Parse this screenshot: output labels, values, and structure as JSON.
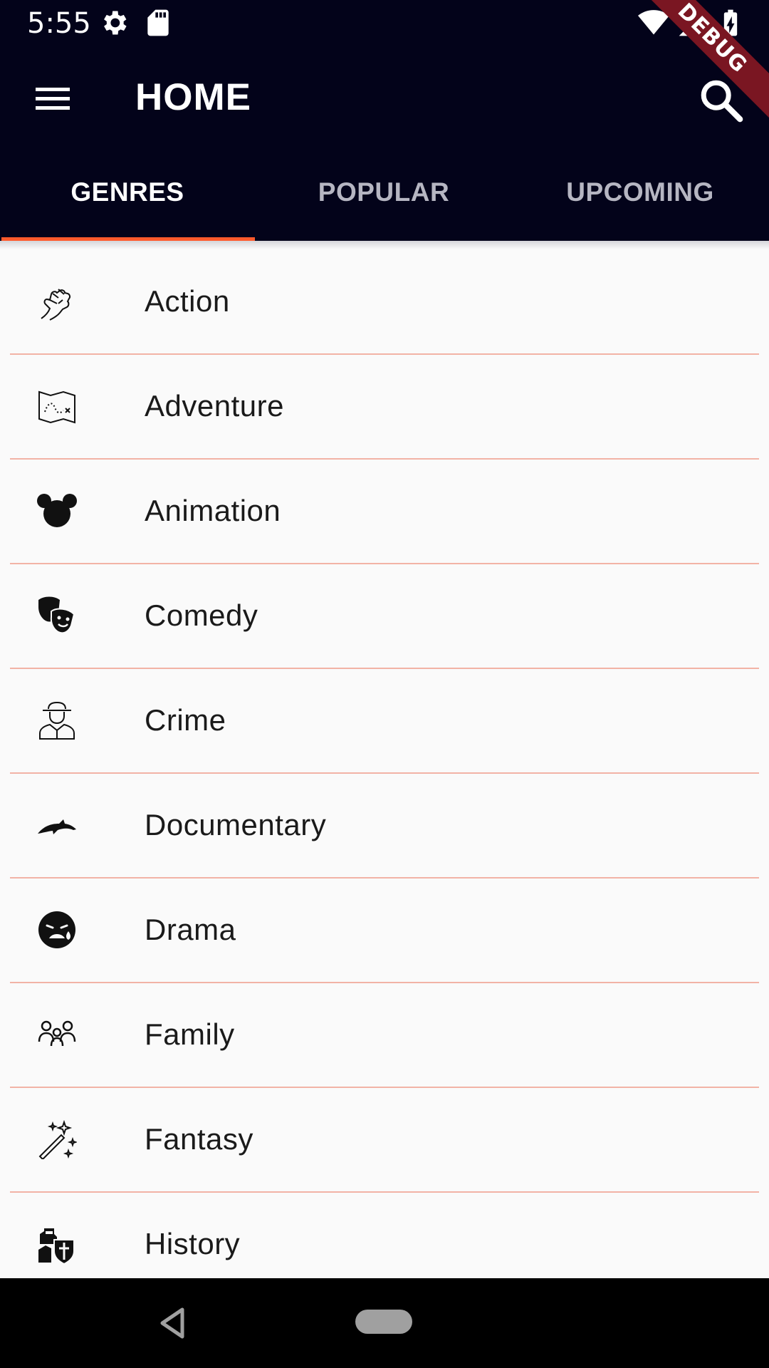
{
  "status_bar": {
    "time": "5:55",
    "icons": [
      "gear-icon",
      "sd-card-icon",
      "wifi-icon",
      "signal-icon",
      "battery-charging-icon"
    ]
  },
  "debug_banner": "DEBUG",
  "app_bar": {
    "title": "HOME",
    "menu_icon": "hamburger-menu-icon",
    "search_icon": "search-icon",
    "background": "#03031a"
  },
  "tabs": [
    {
      "label": "GENRES",
      "active": true
    },
    {
      "label": "POPULAR",
      "active": false
    },
    {
      "label": "UPCOMING",
      "active": false
    }
  ],
  "accent_color": "#ff5a2c",
  "genres": [
    {
      "label": "Action",
      "icon": "fist-icon"
    },
    {
      "label": "Adventure",
      "icon": "treasure-map-icon"
    },
    {
      "label": "Animation",
      "icon": "mouse-ears-icon"
    },
    {
      "label": "Comedy",
      "icon": "theater-masks-icon"
    },
    {
      "label": "Crime",
      "icon": "detective-icon"
    },
    {
      "label": "Documentary",
      "icon": "dolphin-icon"
    },
    {
      "label": "Drama",
      "icon": "crying-face-icon"
    },
    {
      "label": "Family",
      "icon": "family-icon"
    },
    {
      "label": "Fantasy",
      "icon": "magic-wand-icon"
    },
    {
      "label": "History",
      "icon": "knight-shield-icon"
    }
  ],
  "nav_bar": {
    "back_icon": "nav-back-icon",
    "home_icon": "nav-home-pill-icon"
  }
}
